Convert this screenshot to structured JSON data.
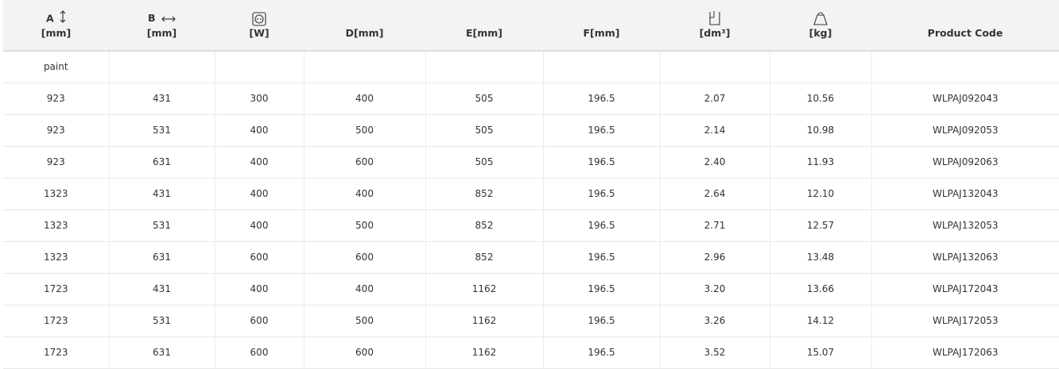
{
  "header": {
    "col_a": {
      "letter": "A",
      "unit": "[mm]",
      "icon": "vertical-arrow-icon"
    },
    "col_b": {
      "letter": "B",
      "unit": "[mm]",
      "icon": "horizontal-arrow-icon"
    },
    "col_w": {
      "unit": "[W]",
      "icon": "power-outlet-icon"
    },
    "col_d": {
      "label": "D[mm]"
    },
    "col_e": {
      "label": "E[mm]"
    },
    "col_f": {
      "label": "F[mm]"
    },
    "col_vol": {
      "unit": "[dm³]",
      "icon": "container-volume-icon"
    },
    "col_kg": {
      "unit": "[kg]",
      "icon": "weight-icon"
    },
    "col_code": {
      "label": "Product Code"
    }
  },
  "first_row": {
    "label": "paint"
  },
  "rows": [
    [
      "923",
      "431",
      "300",
      "400",
      "505",
      "196.5",
      "2.07",
      "10.56",
      "WLPAJ092043"
    ],
    [
      "923",
      "531",
      "400",
      "500",
      "505",
      "196.5",
      "2.14",
      "10.98",
      "WLPAJ092053"
    ],
    [
      "923",
      "631",
      "400",
      "600",
      "505",
      "196.5",
      "2.40",
      "11.93",
      "WLPAJ092063"
    ],
    [
      "1323",
      "431",
      "400",
      "400",
      "852",
      "196.5",
      "2.64",
      "12.10",
      "WLPAJ132043"
    ],
    [
      "1323",
      "531",
      "400",
      "500",
      "852",
      "196.5",
      "2.71",
      "12.57",
      "WLPAJ132053"
    ],
    [
      "1323",
      "631",
      "600",
      "600",
      "852",
      "196.5",
      "2.96",
      "13.48",
      "WLPAJ132063"
    ],
    [
      "1723",
      "431",
      "400",
      "400",
      "1162",
      "196.5",
      "3.20",
      "13.66",
      "WLPAJ172043"
    ],
    [
      "1723",
      "531",
      "600",
      "500",
      "1162",
      "196.5",
      "3.26",
      "14.12",
      "WLPAJ172053"
    ],
    [
      "1723",
      "631",
      "600",
      "600",
      "1162",
      "196.5",
      "3.52",
      "15.07",
      "WLPAJ172063"
    ]
  ]
}
